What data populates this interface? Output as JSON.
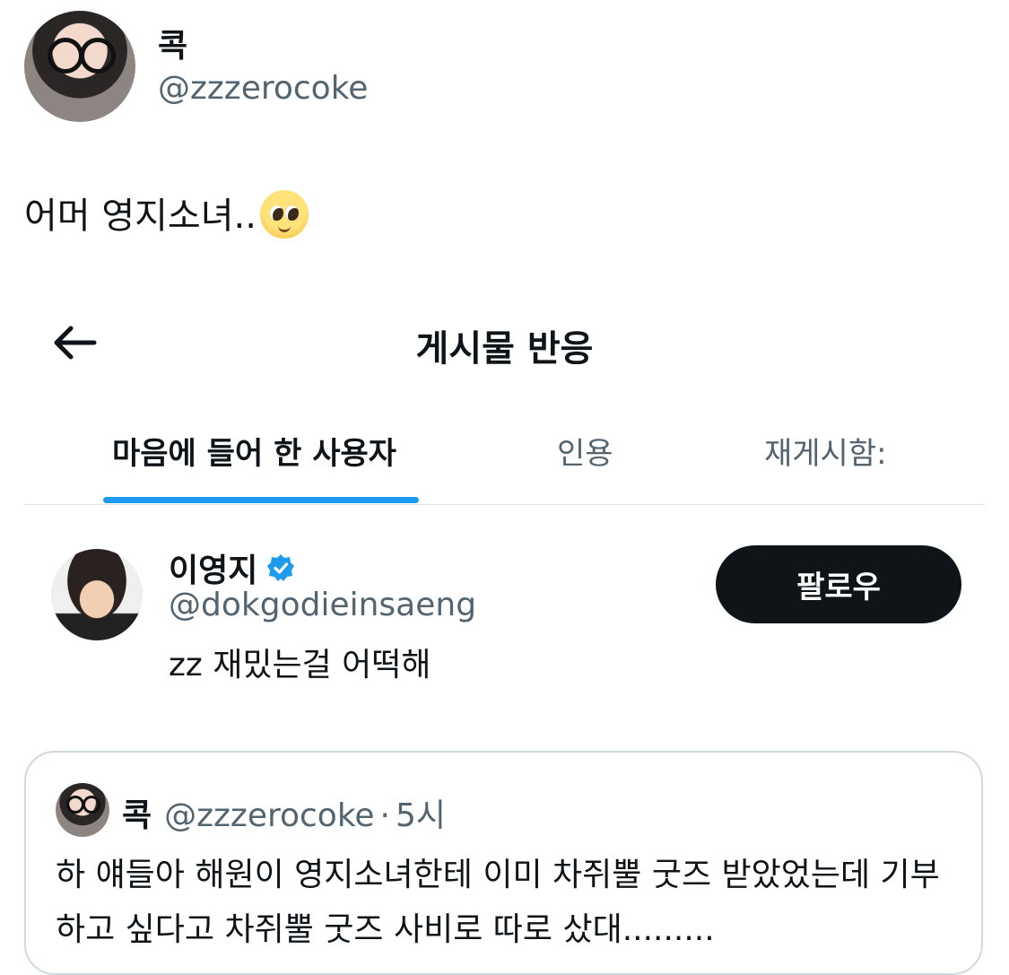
{
  "tweet": {
    "author_name": "콕",
    "author_handle": "@zzzerocoke",
    "text": "어머 영지소녀..",
    "emoji": "pleading-face"
  },
  "screen": {
    "title": "게시물 반응",
    "tabs": [
      {
        "label": "마음에 들어 한 사용자",
        "active": true
      },
      {
        "label": "인용",
        "active": false
      },
      {
        "label": "재게시함:",
        "active": false
      }
    ],
    "accent_color": "#1d9bf0"
  },
  "user": {
    "name": "이영지",
    "verified": true,
    "handle": "@dokgodieinsaeng",
    "bio": "zz 재밌는걸 어떡해",
    "follow_label": "팔로우"
  },
  "quote": {
    "name": "콕",
    "handle": "@zzzerocoke",
    "separator": "·",
    "time": "5시",
    "text": "하 얘들아 해원이 영지소녀한테 이미 차쥐뿔 굿즈 받았었는데 기부 하고 싶다고 차쥐뿔 굿즈 사비로 따로 샀대........."
  }
}
